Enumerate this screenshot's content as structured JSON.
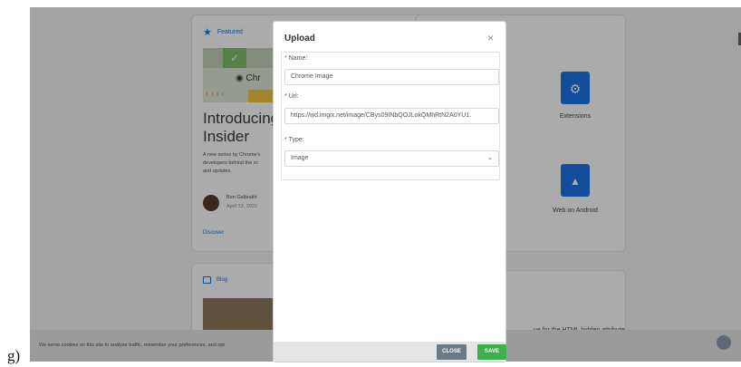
{
  "side_label": "g)",
  "featured": {
    "section_label": "Featured",
    "image_text": "Chr",
    "title": "Introducing\nInsider",
    "description": "A new series by Chrome's\ndevelopers behind the sc\nand updates.",
    "author": "Ben Galbraith",
    "date": "April 13, 2022",
    "link": "Discover"
  },
  "right_card": {
    "extensions_label": "Extensions",
    "web_on_android_label": "Web on Android"
  },
  "blog": {
    "section_label": "Blog"
  },
  "blog2": {
    "snippet": "ue for the HTML hidden attribute"
  },
  "cookie": {
    "text": "We serve cookies on this site to analyze traffic, remember your preferences, and opt"
  },
  "modal": {
    "title": "Upload",
    "close_symbol": "×",
    "name_label": "Name:",
    "name_value": "Chrome Image",
    "url_label": "Url:",
    "url_value": "https://wd.imgix.net/image/CBys09INbQOJLokQMhRtN2A0YU1.",
    "type_label": "Type:",
    "type_value": "Image",
    "required_mark": "*",
    "close_button": "CLOSE",
    "save_button": "SAVE"
  },
  "colors": {
    "accent": "#1a73e8",
    "save": "#3cb04a",
    "close_button": "#6c7a86",
    "required": "#dd3333"
  },
  "icons": [
    "star-icon",
    "puzzle-icon",
    "android-icon",
    "blog-icon",
    "close-icon",
    "chevron-down-icon"
  ]
}
